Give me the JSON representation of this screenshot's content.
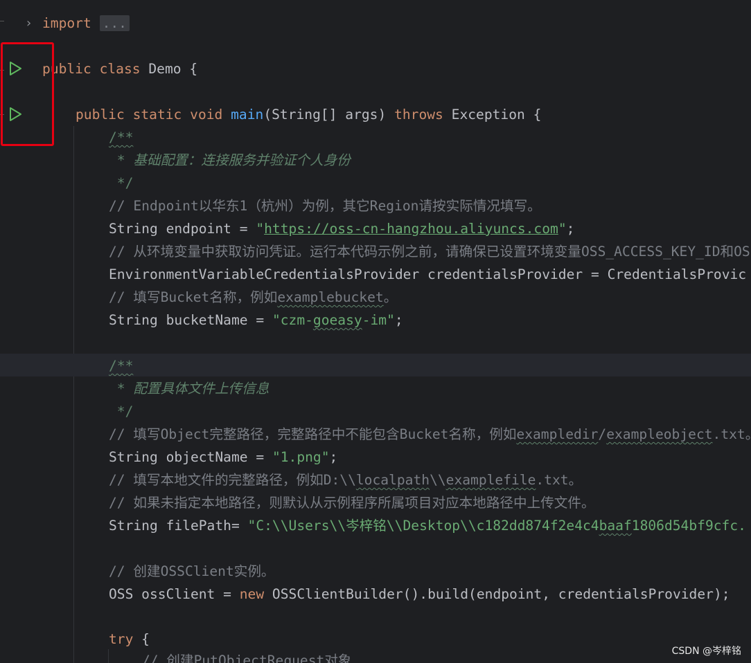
{
  "editor": {
    "line1": {
      "kw": "import",
      "fold": "..."
    },
    "line2": {
      "kw": "public class",
      "name": "Demo",
      "brace": " {"
    },
    "line3": {
      "kw1": "public static void",
      "fn": "main",
      "params": "(String[] args) ",
      "kw2": "throws",
      "rest": " Exception {"
    },
    "doc1": {
      "open": "/**",
      "text": " * 基础配置：连接服务并验证个人身份",
      "close": " */"
    },
    "line_c1": "// Endpoint以华东1（杭州）为例，其它Region请按实际情况填写。",
    "line_endpoint": {
      "pre": "String endpoint = ",
      "q1": "\"",
      "url": "https://oss-cn-hangzhou.aliyuncs.com",
      "q2": "\"",
      "post": ";"
    },
    "line_c2": "// 从环境变量中获取访问凭证。运行本代码示例之前，请确保已设置环境变量OSS_ACCESS_KEY_ID和OSS_",
    "line_cred": "EnvironmentVariableCredentialsProvider credentialsProvider = CredentialsProvic",
    "line_c3": {
      "pre": "// 填写Bucket名称，例如",
      "typo": "examplebucket",
      "post": "。"
    },
    "line_bucket": {
      "pre": "String bucketName = ",
      "s1": "\"czm-",
      "typo": "goeasy",
      "s2": "-im\"",
      "post": ";"
    },
    "doc2": {
      "open": "/**",
      "text": " * 配置具体文件上传信息",
      "close": " */"
    },
    "line_c4": {
      "pre": "// 填写Object完整路径，完整路径中不能包含Bucket名称，例如",
      "t1": "exampledir",
      "mid": "/",
      "t2": "exampleobject",
      "post": ".txt。"
    },
    "line_object": {
      "pre": "String objectName = ",
      "str": "\"1.png\"",
      "post": ";"
    },
    "line_c5": {
      "pre": "// 填写本地文件的完整路径，例如D:\\\\",
      "t1": "localpath",
      "mid": "\\\\",
      "t2": "examplefile",
      "post": ".txt。"
    },
    "line_c6": "// 如果未指定本地路径，则默认从示例程序所属项目对应本地路径中上传文件。",
    "line_filepath": {
      "pre": "String filePath= ",
      "s1": "\"C:\\\\Users\\\\岑梓铭\\\\Desktop\\\\c182dd874f2e4c4",
      "typo": "baaf",
      "s2": "1806d54bf9cfc."
    },
    "line_c7": "// 创建OSSClient实例。",
    "line_oss": {
      "pre": "OSS ossClient = ",
      "kw": "new",
      "post": " OSSClientBuilder().build(endpoint, credentialsProvider);"
    },
    "line_try": {
      "kw": "try",
      "post": " {"
    },
    "line_c8": "// 创建PutObjectRequest对象"
  },
  "watermark": "CSDN @岑梓铭",
  "colors": {
    "highlight_box": "#e60012",
    "run_icon": "#5fb85f",
    "keyword": "#cf8e6d",
    "string": "#6aab73",
    "function": "#56a8f5"
  }
}
